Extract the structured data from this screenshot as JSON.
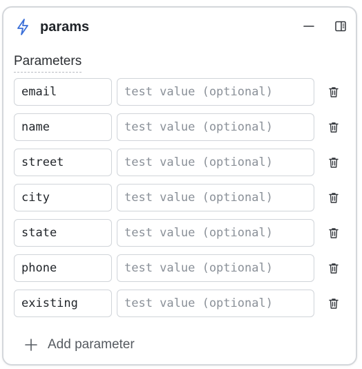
{
  "node": {
    "title": "params",
    "icon": "lightning-bolt-icon",
    "accent_color": "#3a6fd8",
    "controls": [
      "minimize-icon",
      "side-panel-icon"
    ]
  },
  "parameters": {
    "label": "Parameters",
    "value_placeholder": "test value (optional)",
    "items": [
      {
        "name": "email",
        "value": ""
      },
      {
        "name": "name",
        "value": ""
      },
      {
        "name": "street",
        "value": ""
      },
      {
        "name": "city",
        "value": ""
      },
      {
        "name": "state",
        "value": ""
      },
      {
        "name": "phone",
        "value": ""
      },
      {
        "name": "existing",
        "value": ""
      }
    ],
    "delete_icon": "trash-icon"
  },
  "add_parameter": {
    "label": "Add parameter",
    "icon": "plus-icon"
  }
}
